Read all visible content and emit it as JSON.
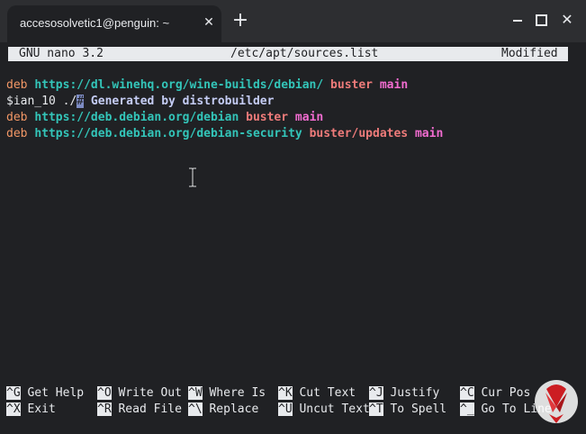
{
  "window": {
    "tab_title": "accesosolvetic1@penguin: ~",
    "tab_close_glyph": "✕",
    "new_tab_glyph": "+",
    "close_glyph": "✕"
  },
  "nano": {
    "version": "GNU nano 3.2",
    "filename": "/etc/apt/sources.list",
    "status": "Modified"
  },
  "lines": [
    {
      "keyword": "deb",
      "url": "https://dl.winehq.org/wine-builds/debian/",
      "suite": "buster",
      "component": "main"
    },
    {
      "prefix": "$ian_10 ./",
      "cursor_char": "#",
      "comment": " Generated by distrobuilder"
    },
    {
      "keyword": "deb",
      "url": "https://deb.debian.org/debian",
      "suite": "buster",
      "component": "main"
    },
    {
      "keyword": "deb",
      "url": "https://deb.debian.org/debian-security",
      "suite": "buster/updates",
      "component": "main"
    }
  ],
  "shortcuts": [
    {
      "key": "^G",
      "label": "Get Help"
    },
    {
      "key": "^X",
      "label": "Exit"
    },
    {
      "key": "^O",
      "label": "Write Out"
    },
    {
      "key": "^R",
      "label": "Read File"
    },
    {
      "key": "^W",
      "label": "Where Is"
    },
    {
      "key": "^\\",
      "label": "Replace"
    },
    {
      "key": "^K",
      "label": "Cut Text"
    },
    {
      "key": "^U",
      "label": "Uncut Text"
    },
    {
      "key": "^J",
      "label": "Justify"
    },
    {
      "key": "^T",
      "label": "To Spell"
    },
    {
      "key": "^C",
      "label": "Cur Pos"
    },
    {
      "key": "^_",
      "label": "Go To Line"
    }
  ],
  "colors": {
    "background": "#202124",
    "keyword": "#f29766",
    "url": "#33c5b9",
    "suite": "#ee7b7a",
    "component": "#f16cd0",
    "comment": "#c5cdf5"
  },
  "icons": {
    "mouse_cursor": "ibeam-cursor-icon",
    "logo": "solvetic-logo-icon"
  }
}
